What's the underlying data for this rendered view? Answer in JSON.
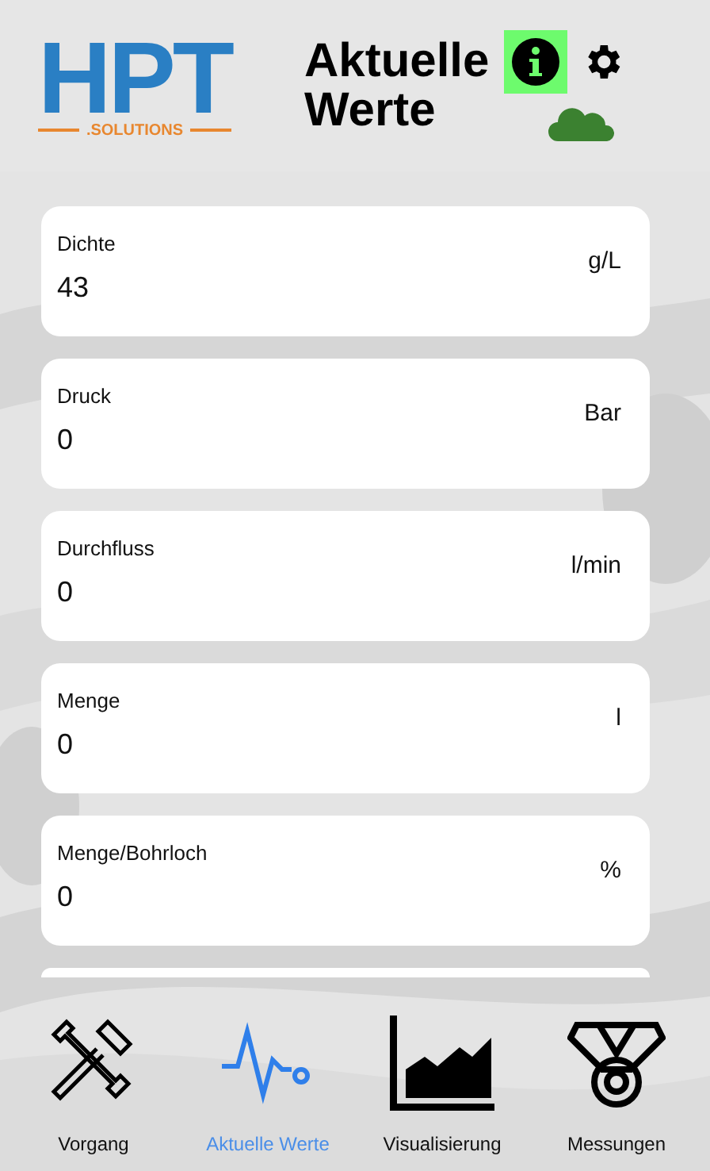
{
  "header": {
    "logo": {
      "wordmark": "HPT",
      "tagline": ".SOLUTIONS"
    },
    "title": "Aktuelle Werte",
    "info_highlighted": true,
    "cloud_connected": true
  },
  "values": [
    {
      "label": "Dichte",
      "value": "43",
      "unit": "g/L"
    },
    {
      "label": "Druck",
      "value": "0",
      "unit": "Bar"
    },
    {
      "label": "Durchfluss",
      "value": "0",
      "unit": "l/min"
    },
    {
      "label": "Menge",
      "value": "0",
      "unit": "l"
    },
    {
      "label": "Menge/Bohrloch",
      "value": "0",
      "unit": "%"
    }
  ],
  "tabs": [
    {
      "kind": "tools",
      "label": "Vorgang",
      "selected": false
    },
    {
      "kind": "pulse",
      "label": "Aktuelle Werte",
      "selected": true
    },
    {
      "kind": "chart",
      "label": "Visualisierung",
      "selected": false
    },
    {
      "kind": "medal",
      "label": "Messungen",
      "selected": false
    }
  ]
}
